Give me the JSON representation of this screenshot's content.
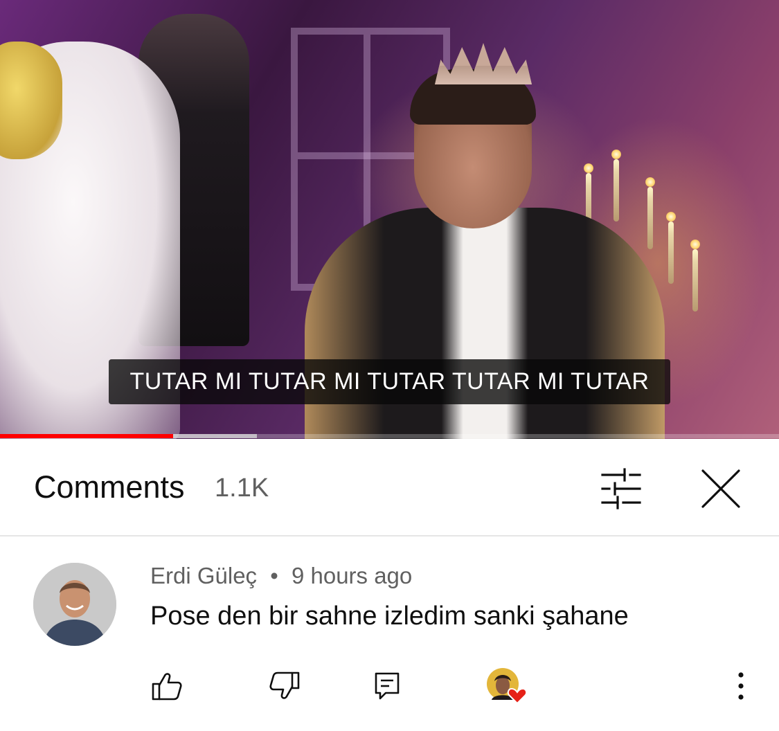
{
  "player": {
    "caption": "TUTAR MI TUTAR MI TUTAR TUTAR MI TUTAR",
    "progress_played_fraction": 0.222,
    "progress_buffered_fraction": 0.33,
    "progress_color": "#ff0000"
  },
  "comments_panel": {
    "title": "Comments",
    "count": "1.1K",
    "filter_icon": "sliders-icon",
    "close_icon": "close-icon"
  },
  "comment": {
    "author": "Erdi Güleç",
    "separator": "•",
    "time": "9 hours ago",
    "text": "Pose den bir sahne izledim sanki şahane",
    "actions": {
      "like_icon": "thumbs-up-icon",
      "dislike_icon": "thumbs-down-icon",
      "reply_icon": "reply-icon",
      "creator_heart_icon": "creator-heart-icon",
      "more_icon": "more-vertical-icon"
    }
  },
  "colors": {
    "text_primary": "#0f0f0f",
    "text_secondary": "#606060",
    "heart": "#e62117"
  }
}
